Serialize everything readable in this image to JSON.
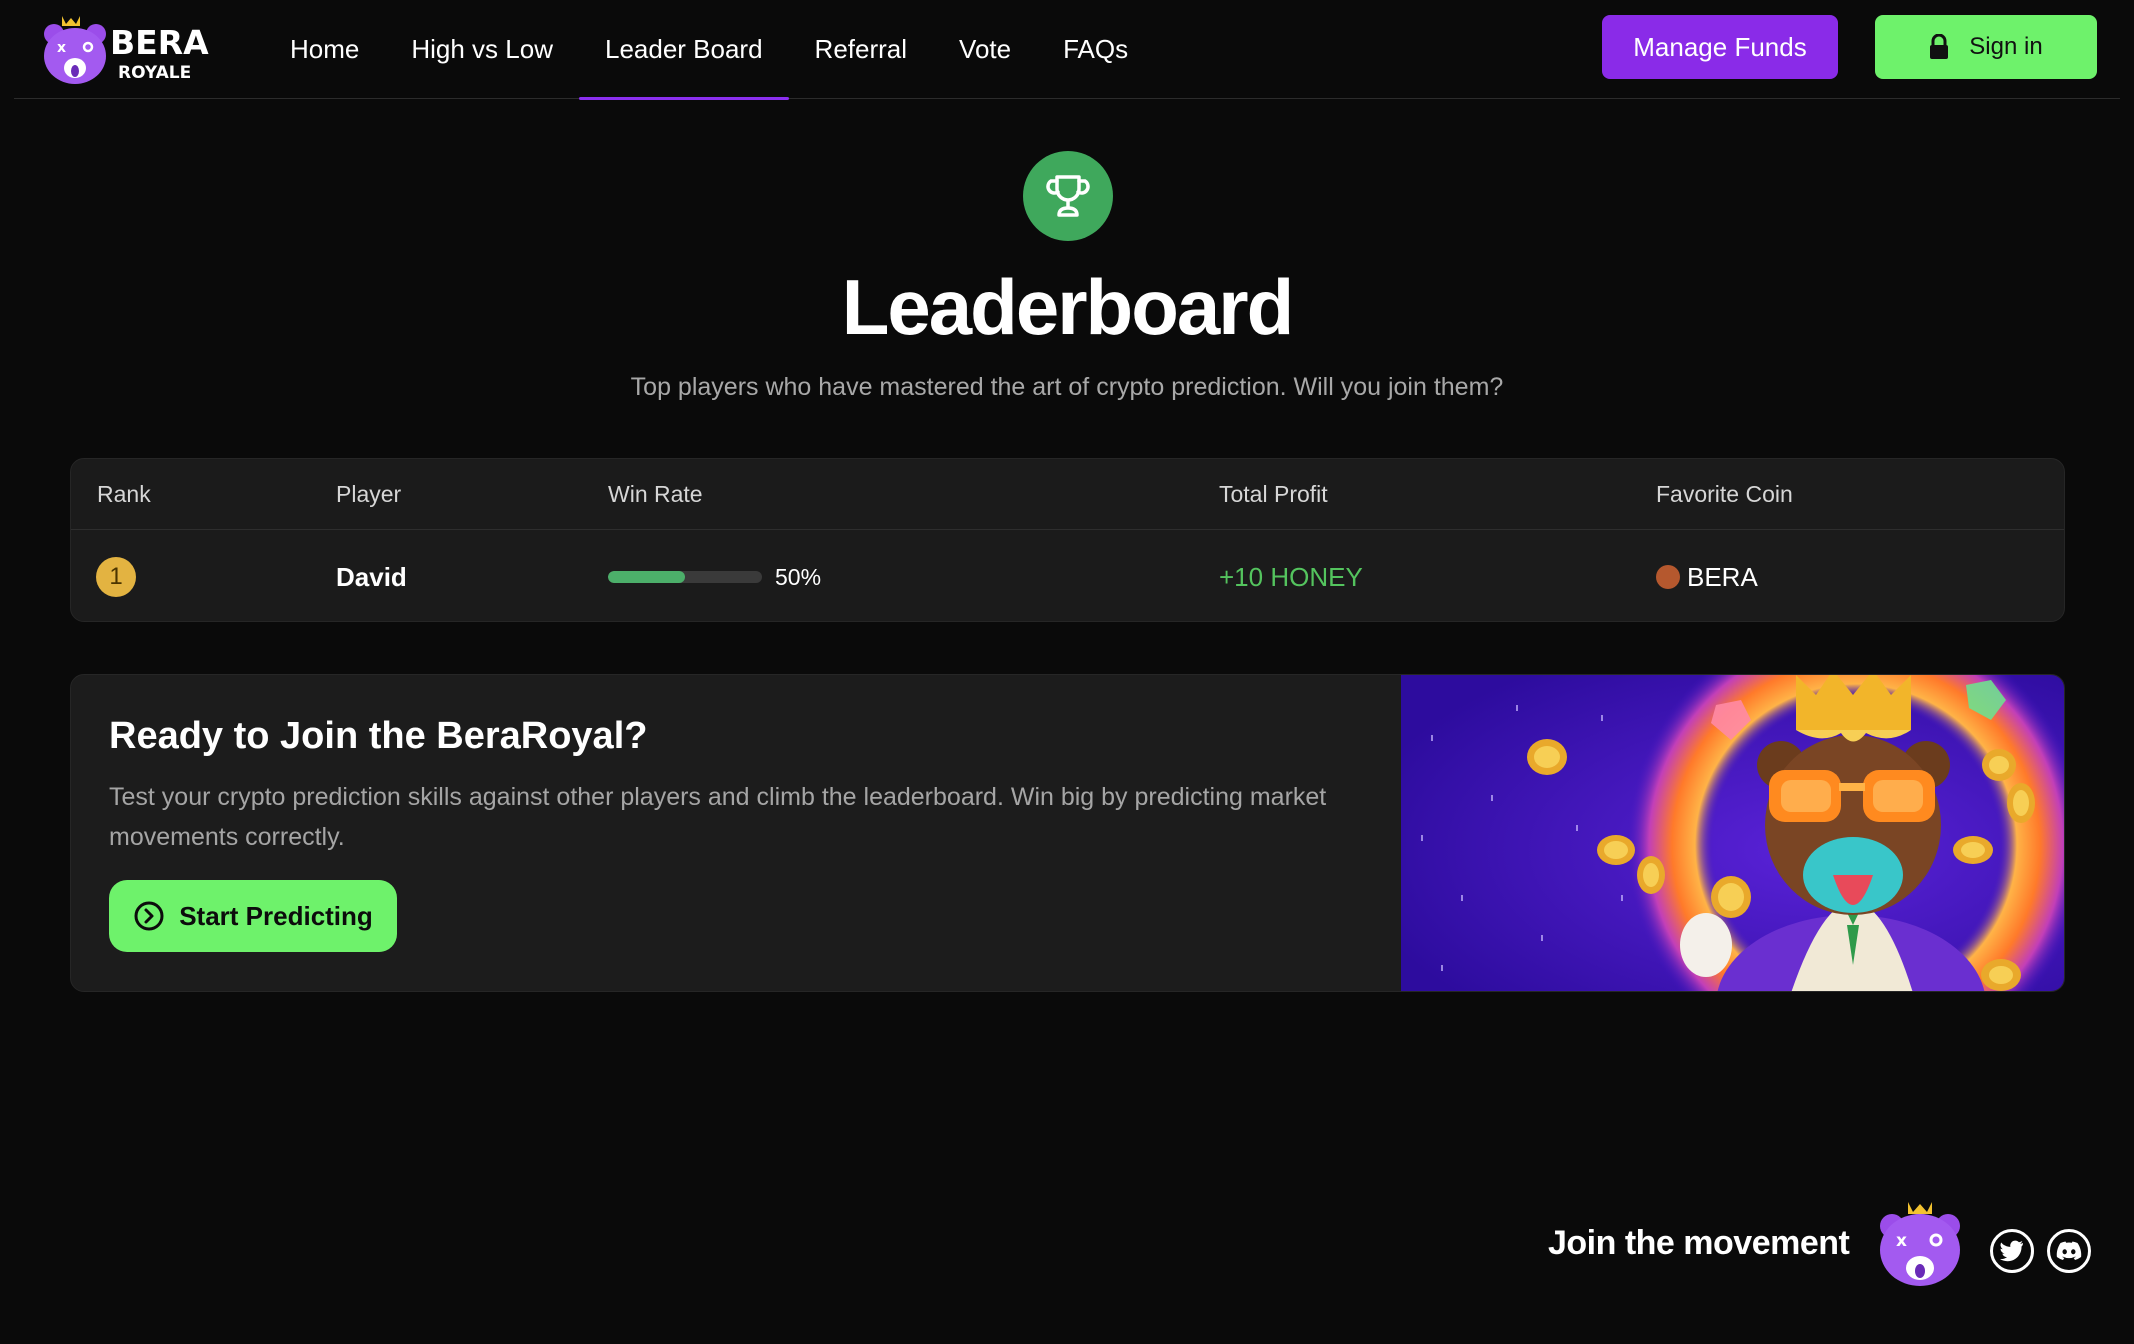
{
  "nav": {
    "logo_line1": "BERA",
    "logo_line2": "ROYALE",
    "links": [
      {
        "label": "Home",
        "active": false
      },
      {
        "label": "High vs Low",
        "active": false
      },
      {
        "label": "Leader Board",
        "active": true
      },
      {
        "label": "Referral",
        "active": false
      },
      {
        "label": "Vote",
        "active": false
      },
      {
        "label": "FAQs",
        "active": false
      }
    ],
    "manage_funds_label": "Manage Funds",
    "sign_in_label": "Sign in"
  },
  "hero": {
    "icon": "trophy-icon",
    "title": "Leaderboard",
    "subtitle": "Top players who have mastered the art of crypto prediction. Will you join them?"
  },
  "leaderboard": {
    "columns": [
      "Rank",
      "Player",
      "Win Rate",
      "Total Profit",
      "Favorite Coin"
    ],
    "rows": [
      {
        "rank": "1",
        "player": "David",
        "win_rate": 50,
        "win_rate_label": "50%",
        "profit": "+10 HONEY",
        "coin": "BERA"
      }
    ]
  },
  "cta": {
    "title": "Ready to Join the BeraRoyal?",
    "text": "Test your crypto prediction skills against other players and climb the leaderboard. Win big by predicting market movements correctly.",
    "button_label": "Start Predicting"
  },
  "footer": {
    "text": "Join the movement",
    "social": [
      "twitter-icon",
      "discord-icon"
    ]
  },
  "colors": {
    "background": "#0a0a0a",
    "accent_purple": "#8a2be8",
    "accent_green": "#6ef26b",
    "profit_green": "#54c45e",
    "rank_gold": "#e3b341"
  }
}
